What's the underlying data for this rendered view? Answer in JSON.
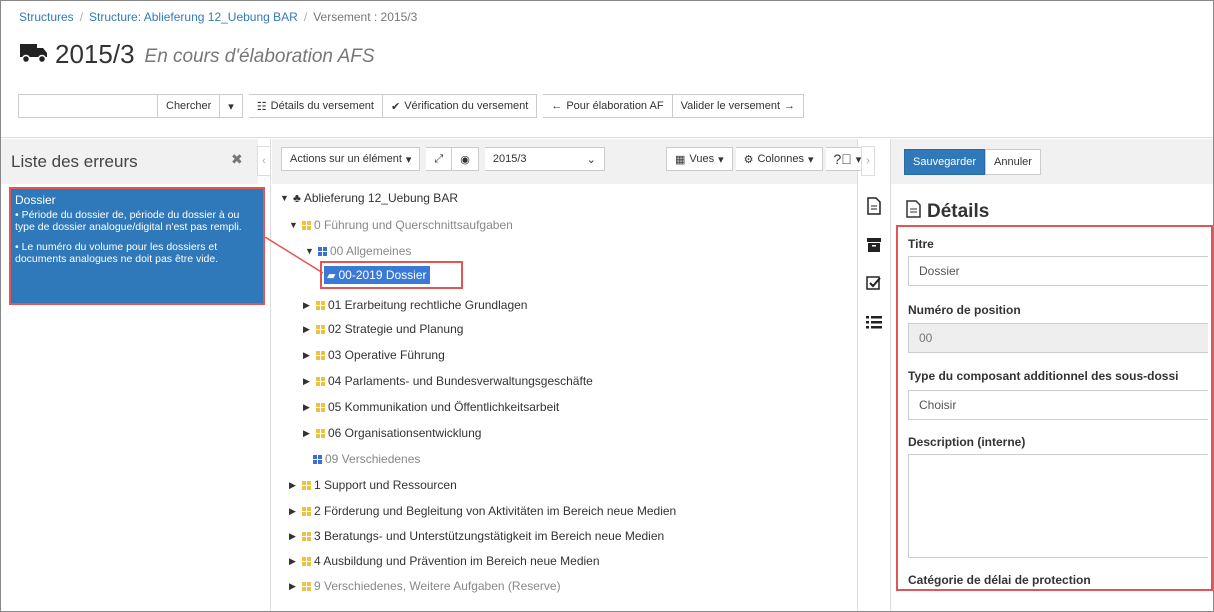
{
  "breadcrumb": {
    "items": [
      "Structures",
      "Structure: Ablieferung 12_Uebung BAR",
      "Versement : 2015/3"
    ]
  },
  "page": {
    "title": "2015/3",
    "subtitle": "En cours d'élaboration AFS",
    "title_icon": "truck-icon"
  },
  "toolbar": {
    "search_placeholder": "",
    "search_button": "Chercher",
    "details_button": "Détails du versement",
    "verify_button": "Vérification du versement",
    "back_button": "Pour élaboration AF",
    "validate_button": "Valider le versement"
  },
  "errors_panel": {
    "title": "Liste des erreurs",
    "error": {
      "heading": "Dossier",
      "messages": [
        "Période du dossier de, période du dossier à ou type de dossier analogue/digital n'est pas rempli.",
        "Le numéro du volume pour les dossiers et documents analogues ne doit pas être vide."
      ]
    }
  },
  "tree_toolbar": {
    "actions_button": "Actions sur un élément",
    "version_select": "2015/3",
    "views_button": "Vues",
    "columns_button": "Colonnes"
  },
  "tree": {
    "root": "Ablieferung 12_Uebung BAR",
    "nodes": [
      "0 Führung und Querschnittsaufgaben",
      "00 Allgemeines",
      "00-2019 Dossier",
      "01 Erarbeitung rechtliche Grundlagen",
      "02 Strategie und Planung",
      "03 Operative Führung",
      "04 Parlaments- und Bundesverwaltungsgeschäfte",
      "05 Kommunikation und Öffentlichkeitsarbeit",
      "06 Organisationsentwicklung",
      "09 Verschiedenes",
      "1 Support und Ressourcen",
      "2 Förderung und Begleitung von Aktivitäten im Bereich neue Medien",
      "3 Beratungs- und Unterstützungstätigkeit im Bereich neue Medien",
      "4 Ausbildung und Prävention im Bereich neue Medien",
      "9 Verschiedenes, Weitere Aufgaben (Reserve)"
    ]
  },
  "details": {
    "save_button": "Sauvegarder",
    "cancel_button": "Annuler",
    "title": "Détails",
    "fields": {
      "titre_label": "Titre",
      "titre_value": "Dossier",
      "position_label": "Numéro de position",
      "position_value": "00",
      "type_label": "Type du composant additionnel des sous-dossi",
      "type_value": "Choisir",
      "description_label": "Description (interne)",
      "protection_label": "Catégorie de délai de protection"
    }
  },
  "colors": {
    "accent": "#2f78b9",
    "highlight_border": "#e05555",
    "folder_yellow": "#f0c040",
    "folder_blue": "#3a6fd8"
  }
}
